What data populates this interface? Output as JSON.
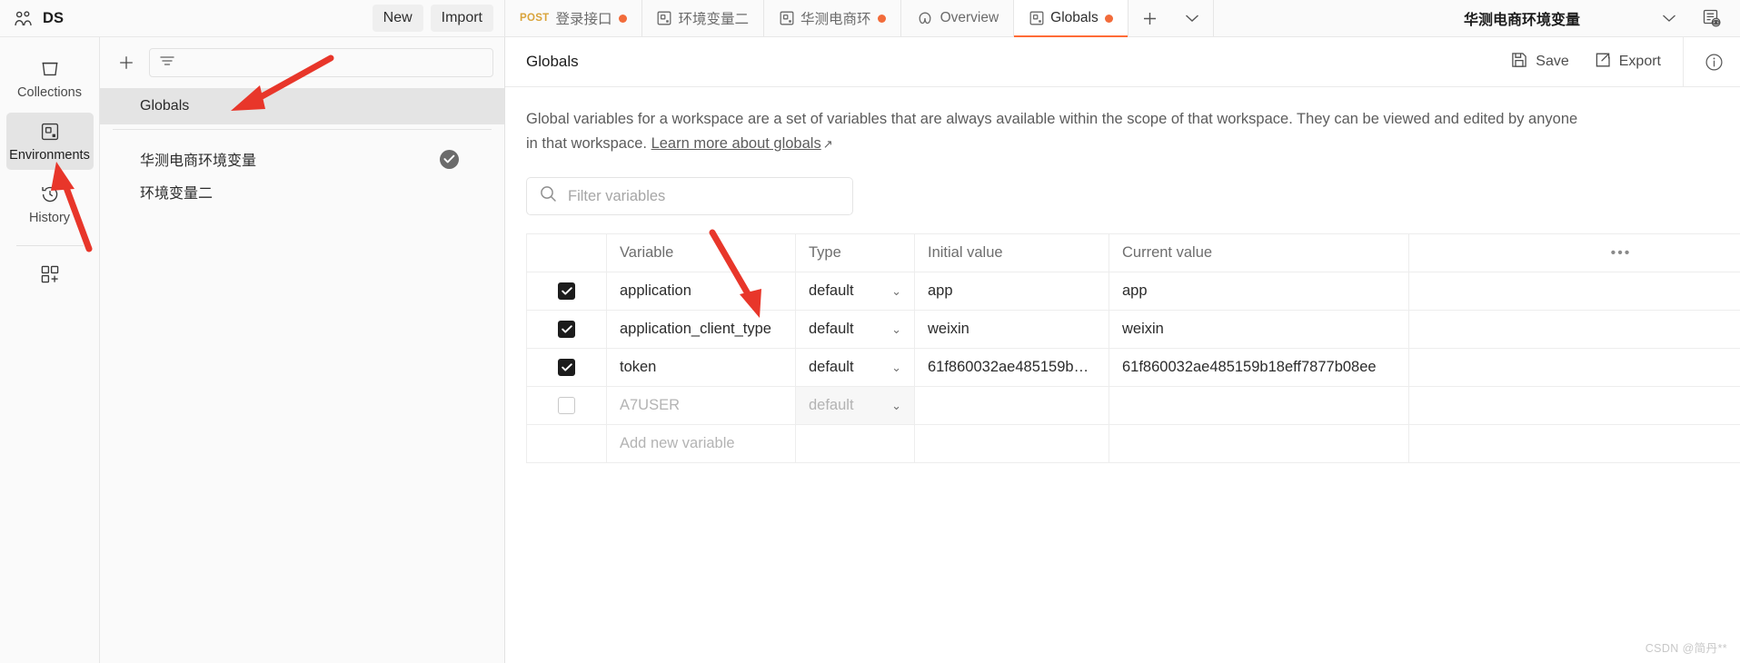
{
  "topbar": {
    "workspace_icon": "users-icon",
    "workspace_name": "DS",
    "new_label": "New",
    "import_label": "Import",
    "tabs": [
      {
        "method": "POST",
        "label": "登录接口",
        "icon": "",
        "unsaved": true,
        "active": false
      },
      {
        "method": "",
        "label": "环境变量二",
        "icon": "environment-icon",
        "unsaved": false,
        "active": false
      },
      {
        "method": "",
        "label": "华测电商环",
        "icon": "environment-icon",
        "unsaved": true,
        "active": false
      },
      {
        "method": "",
        "label": "Overview",
        "icon": "overview-icon",
        "unsaved": false,
        "active": false
      },
      {
        "method": "",
        "label": "Globals",
        "icon": "environment-icon",
        "unsaved": true,
        "active": true
      }
    ],
    "new_tab_icon": "plus-icon",
    "tab_list_icon": "chevron-down-icon",
    "environment_selector": {
      "value": "华测电商环境变量",
      "chevron": "chevron-down-icon"
    },
    "eye_icon": "environment-quick-look-icon"
  },
  "rail": {
    "items": [
      {
        "label": "Collections",
        "icon": "collections-icon",
        "active": false
      },
      {
        "label": "Environments",
        "icon": "environments-icon",
        "active": true
      },
      {
        "label": "History",
        "icon": "history-icon",
        "active": false
      }
    ],
    "extra_icon": "add-module-icon"
  },
  "envpanel": {
    "add_icon": "plus-icon",
    "filter_icon": "filter-icon",
    "globals_row": {
      "label": "Globals",
      "selected": true
    },
    "environments": [
      {
        "label": "华测电商环境变量",
        "active": true,
        "check_icon": "check-circle-icon"
      },
      {
        "label": "环境变量二",
        "active": false,
        "check_icon": ""
      }
    ]
  },
  "main": {
    "title": "Globals",
    "save_label": "Save",
    "save_icon": "save-icon",
    "export_label": "Export",
    "export_icon": "export-icon",
    "info_icon": "info-icon",
    "description_part1": "Global variables for a workspace are a set of variables that are always available within the scope of that workspace. They can be viewed and edited by anyone in that workspace. ",
    "description_link": "Learn more about globals",
    "description_link_arrow": "↗",
    "filter": {
      "icon": "search-icon",
      "placeholder": "Filter variables",
      "value": ""
    },
    "table": {
      "columns": [
        "",
        "Variable",
        "Type",
        "Initial value",
        "Current value"
      ],
      "more_icon": "ellipsis-icon",
      "rows": [
        {
          "checked": true,
          "variable": "application",
          "type": "default",
          "initial": "app",
          "current": "app",
          "placeholder": false
        },
        {
          "checked": true,
          "variable": "application_client_type",
          "type": "default",
          "initial": "weixin",
          "current": "weixin",
          "placeholder": false
        },
        {
          "checked": true,
          "variable": "token",
          "type": "default",
          "initial": "61f860032ae485159b18ef...",
          "current": "61f860032ae485159b18eff7877b08ee",
          "placeholder": false
        },
        {
          "checked": false,
          "variable": "A7USER",
          "type": "default",
          "initial": "",
          "current": "",
          "placeholder": true
        }
      ],
      "add_row_label": "Add new variable"
    }
  },
  "watermark": "CSDN @简丹**",
  "colors": {
    "accent": "#ff6c37",
    "unsaved_dot": "#f26b3a",
    "method_post": "#d9a43b",
    "annotation_arrow": "#e8362a"
  }
}
